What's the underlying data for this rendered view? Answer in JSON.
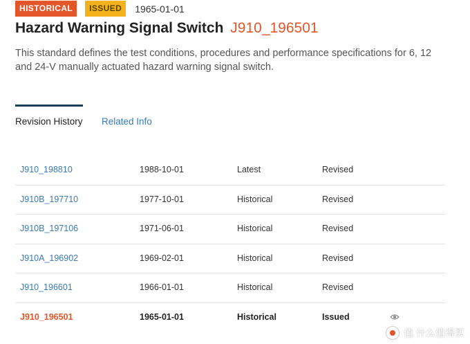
{
  "header": {
    "status_badge": "HISTORICAL",
    "issued_badge": "ISSUED",
    "date": "1965-01-01",
    "title": "Hazard Warning Signal Switch",
    "code": "J910_196501",
    "description": "This standard defines the test conditions, procedures and performance specifications for 6, 12 and 24-V manually actuated hazard warning signal switch."
  },
  "tabs": {
    "revision_history": "Revision History",
    "related_info": "Related Info"
  },
  "revisions": [
    {
      "code": "J910_198810",
      "date": "1988-10-01",
      "status": "Latest",
      "type": "Revised"
    },
    {
      "code": "J910B_197710",
      "date": "1977-10-01",
      "status": "Historical",
      "type": "Revised"
    },
    {
      "code": "J910B_197106",
      "date": "1971-06-01",
      "status": "Historical",
      "type": "Revised"
    },
    {
      "code": "J910A_196902",
      "date": "1969-02-01",
      "status": "Historical",
      "type": "Revised"
    },
    {
      "code": "J910_196601",
      "date": "1966-01-01",
      "status": "Historical",
      "type": "Revised"
    },
    {
      "code": "J910_196501",
      "date": "1965-01-01",
      "status": "Historical",
      "type": "Issued"
    }
  ],
  "watermark": {
    "text": "值 什么值得买"
  },
  "colors": {
    "accent": "#e2562a",
    "issued": "#f4b21d",
    "link": "#3a7ab8",
    "tab_underline": "#17405e"
  },
  "icons": {
    "view": "eye-icon"
  }
}
